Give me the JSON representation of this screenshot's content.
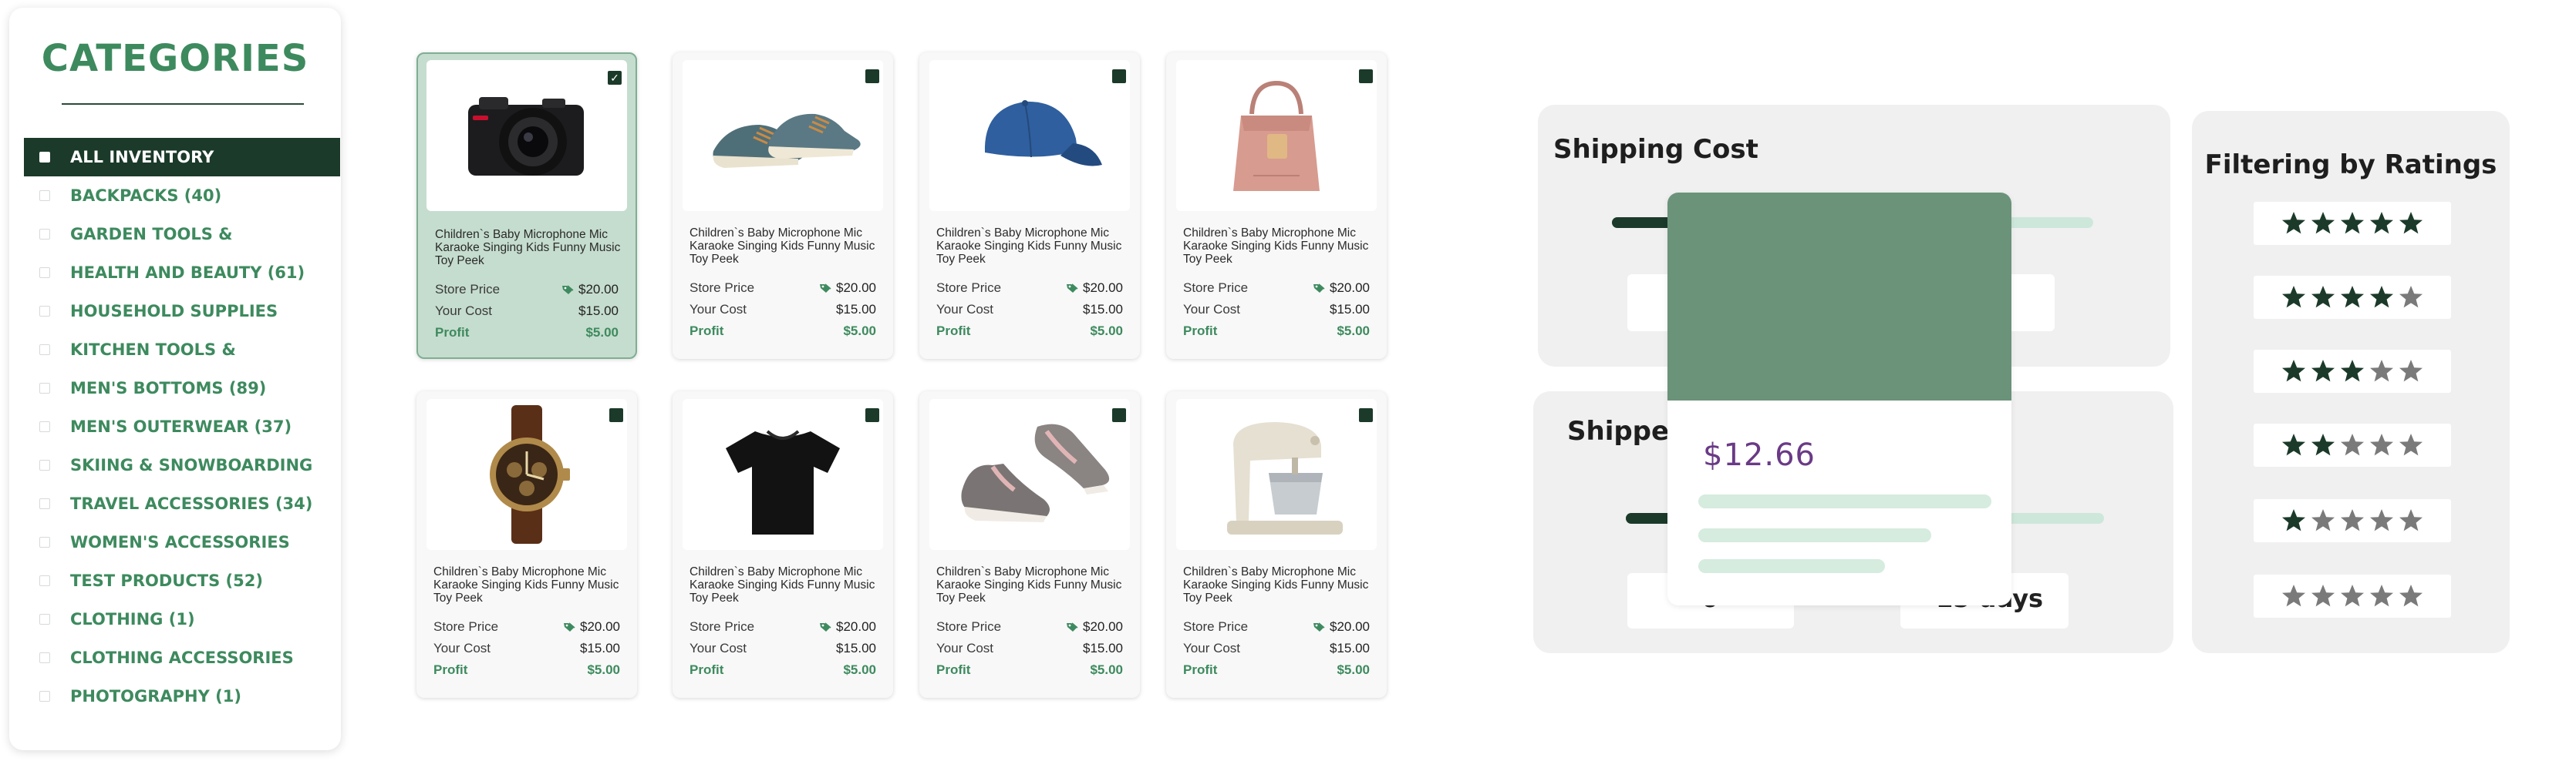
{
  "sidebar": {
    "title": "CATEGORIES",
    "items": [
      {
        "label": "ALL INVENTORY",
        "active": true
      },
      {
        "label": "BACKPACKS (40)"
      },
      {
        "label": "GARDEN TOOLS &"
      },
      {
        "label": "HEALTH AND BEAUTY (61)"
      },
      {
        "label": "HOUSEHOLD SUPPLIES"
      },
      {
        "label": "KITCHEN TOOLS &"
      },
      {
        "label": "MEN'S BOTTOMS (89)"
      },
      {
        "label": "MEN'S OUTERWEAR (37)"
      },
      {
        "label": "SKIING & SNOWBOARDING"
      },
      {
        "label": "TRAVEL ACCESSORIES (34)"
      },
      {
        "label": "WOMEN'S ACCESSORIES"
      },
      {
        "label": "TEST PRODUCTS (52)"
      },
      {
        "label": "CLOTHING (1)"
      },
      {
        "label": "CLOTHING ACCESSORIES"
      },
      {
        "label": "PHOTOGRAPHY (1)"
      }
    ]
  },
  "products": [
    {
      "image": "camera",
      "selected": true,
      "title": "Children`s Baby Microphone Mic Karaoke Singing Kids Funny Music Toy Peek",
      "store_price_label": "Store Price",
      "store_price": "$20.00",
      "cost_label": "Your Cost",
      "cost": "$15.00",
      "profit_label": "Profit",
      "profit": "$5.00"
    },
    {
      "image": "sneakers",
      "selected": false,
      "title": "Children`s Baby Microphone Mic Karaoke Singing Kids Funny Music Toy Peek",
      "store_price_label": "Store Price",
      "store_price": "$20.00",
      "cost_label": "Your Cost",
      "cost": "$15.00",
      "profit_label": "Profit",
      "profit": "$5.00"
    },
    {
      "image": "cap",
      "selected": false,
      "title": "Children`s Baby Microphone Mic Karaoke Singing Kids Funny Music Toy Peek",
      "store_price_label": "Store Price",
      "store_price": "$20.00",
      "cost_label": "Your Cost",
      "cost": "$15.00",
      "profit_label": "Profit",
      "profit": "$5.00"
    },
    {
      "image": "handbag",
      "selected": false,
      "title": "Children`s Baby Microphone Mic Karaoke Singing Kids Funny Music Toy Peek",
      "store_price_label": "Store Price",
      "store_price": "$20.00",
      "cost_label": "Your Cost",
      "cost": "$15.00",
      "profit_label": "Profit",
      "profit": "$5.00"
    },
    {
      "image": "watch",
      "selected": false,
      "title": "Children`s Baby Microphone Mic Karaoke Singing Kids Funny Music Toy Peek",
      "store_price_label": "Store Price",
      "store_price": "$20.00",
      "cost_label": "Your Cost",
      "cost": "$15.00",
      "profit_label": "Profit",
      "profit": "$5.00"
    },
    {
      "image": "tshirt",
      "selected": false,
      "title": "Children`s Baby Microphone Mic Karaoke Singing Kids Funny Music Toy Peek",
      "store_price_label": "Store Price",
      "store_price": "$20.00",
      "cost_label": "Your Cost",
      "cost": "$15.00",
      "profit_label": "Profit",
      "profit": "$5.00"
    },
    {
      "image": "hightops",
      "selected": false,
      "title": "Children`s Baby Microphone Mic Karaoke Singing Kids Funny Music Toy Peek",
      "store_price_label": "Store Price",
      "store_price": "$20.00",
      "cost_label": "Your Cost",
      "cost": "$15.00",
      "profit_label": "Profit",
      "profit": "$5.00"
    },
    {
      "image": "mixer",
      "selected": false,
      "title": "Children`s Baby Microphone Mic Karaoke Singing Kids Funny Music Toy Peek",
      "store_price_label": "Store Price",
      "store_price": "$20.00",
      "cost_label": "Your Cost",
      "cost": "$15.00",
      "profit_label": "Profit",
      "profit": "$5.00"
    }
  ],
  "shipping_cost": {
    "title": "Shipping Cost"
  },
  "shipped": {
    "title": "Shipped",
    "min_value": "0",
    "max_value": "15 days"
  },
  "popup": {
    "price": "$12.66"
  },
  "ratings": {
    "title": "Filtering by Ratings",
    "rows": [
      5,
      4,
      3,
      2,
      1,
      0
    ]
  },
  "colors": {
    "brand_green": "#3d8a5e",
    "dark_green": "#1b3a2a",
    "star_filled": "#1b3a2a",
    "star_empty": "#7a7a7a",
    "price_purple": "#6a3a86"
  }
}
